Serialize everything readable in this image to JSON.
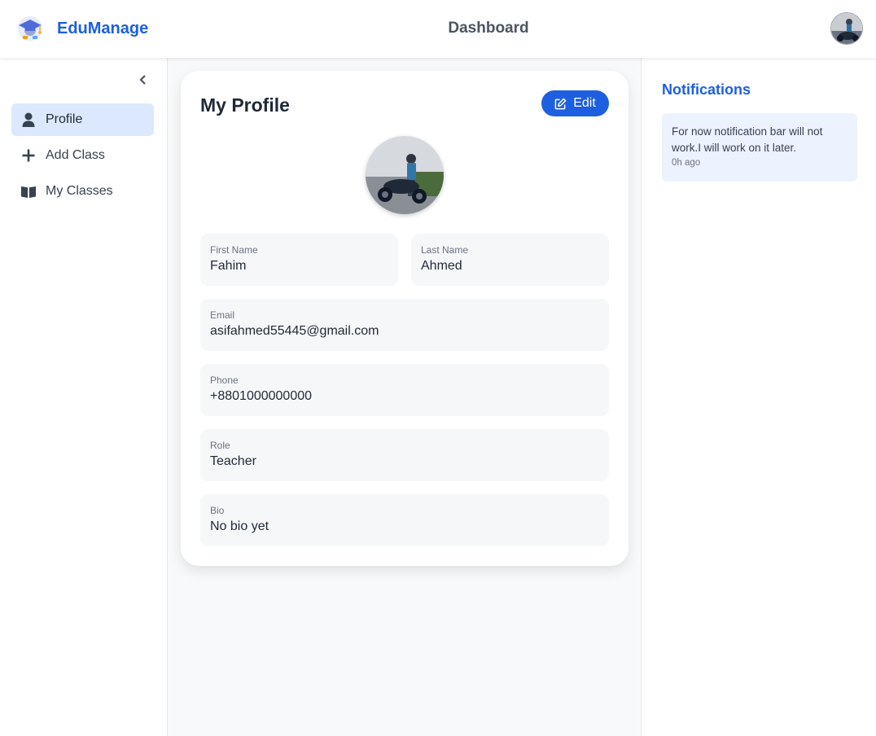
{
  "header": {
    "brand_name": "EduManage",
    "page_title": "Dashboard"
  },
  "sidebar": {
    "items": [
      {
        "label": "Profile",
        "icon": "user-icon",
        "active": true
      },
      {
        "label": "Add Class",
        "icon": "plus-icon",
        "active": false
      },
      {
        "label": "My Classes",
        "icon": "book-icon",
        "active": false
      }
    ]
  },
  "profile": {
    "title": "My Profile",
    "edit_label": "Edit",
    "fields": {
      "first_name": {
        "label": "First Name",
        "value": "Fahim"
      },
      "last_name": {
        "label": "Last Name",
        "value": "Ahmed"
      },
      "email": {
        "label": "Email",
        "value": "asifahmed55445@gmail.com"
      },
      "phone": {
        "label": "Phone",
        "value": "+8801000000000"
      },
      "role": {
        "label": "Role",
        "value": "Teacher"
      },
      "bio": {
        "label": "Bio",
        "value": "No bio yet"
      }
    }
  },
  "notifications": {
    "title": "Notifications",
    "items": [
      {
        "text": "For now notification bar will not work.I will work on it later.",
        "time": "0h ago"
      }
    ]
  },
  "colors": {
    "accent": "#1d5fe0",
    "active_nav_bg": "#dbe8fd",
    "notification_bg": "#edf3fe"
  }
}
